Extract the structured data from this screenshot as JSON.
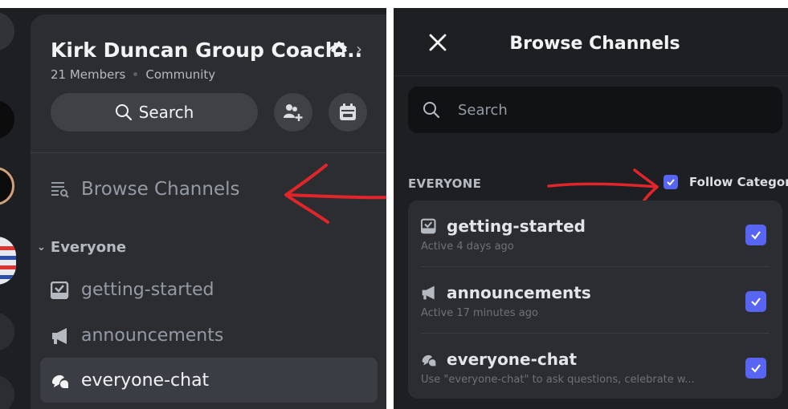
{
  "server": {
    "name": "Kirk Duncan Group Coach...",
    "members": "21 Members",
    "type": "Community",
    "search_label": "Search"
  },
  "left": {
    "browse_label": "Browse Channels",
    "category_label": "Everyone",
    "channels": [
      {
        "name": "getting-started",
        "icon": "rules-checkbox-icon"
      },
      {
        "name": "announcements",
        "icon": "megaphone-icon"
      },
      {
        "name": "everyone-chat",
        "icon": "forum-chat-icon",
        "selected": true
      }
    ]
  },
  "modal": {
    "title": "Browse Channels",
    "search_placeholder": "Search",
    "category": "EVERYONE",
    "follow_label": "Follow Category",
    "follow_checked": true,
    "channels": [
      {
        "name": "getting-started",
        "sub": "Active 4 days ago",
        "checked": true
      },
      {
        "name": "announcements",
        "sub": "Active 17 minutes ago",
        "checked": true
      },
      {
        "name": "everyone-chat",
        "sub": "Use \"everyone-chat\" to ask questions, celebrate w...",
        "checked": true
      }
    ]
  },
  "colors": {
    "background": "#1e1f22",
    "panel": "#2b2d31",
    "accent": "#5865f2",
    "annotation": "#e0262b"
  }
}
